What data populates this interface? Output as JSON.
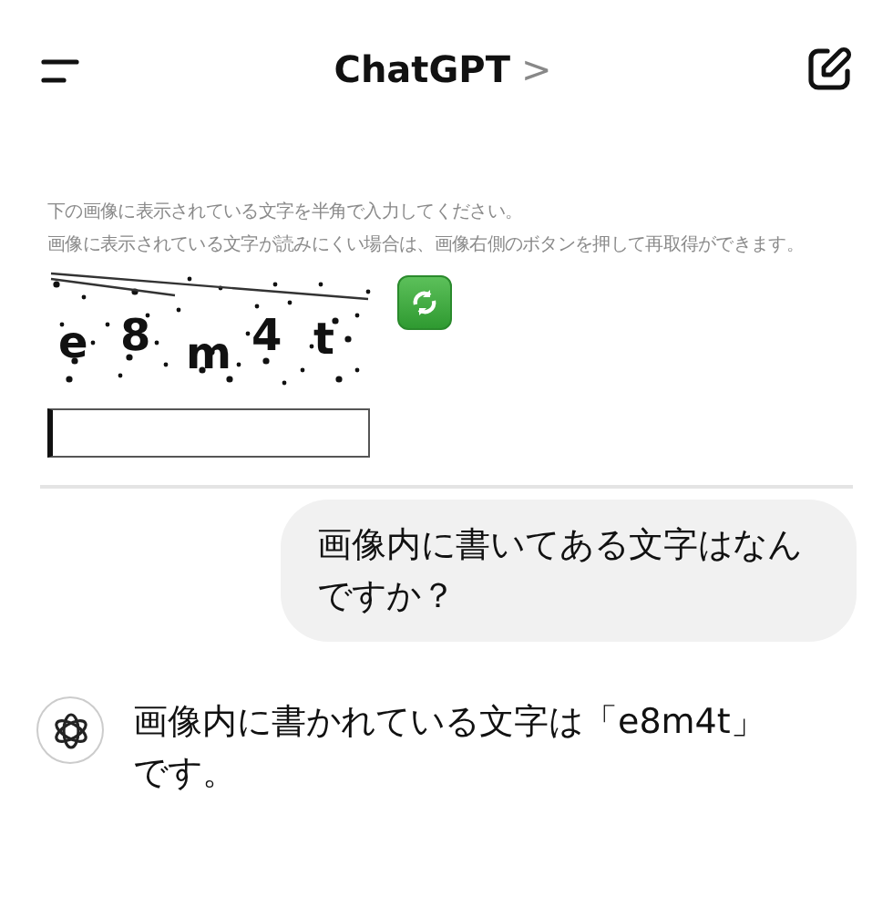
{
  "header": {
    "title": "ChatGPT",
    "chevron": ">"
  },
  "attachment": {
    "instructions": [
      "下の画像に表示されている文字を半角で入力してください。",
      "画像に表示されている文字が読みにくい場合は、画像右側のボタンを押して再取得ができます。"
    ],
    "captcha_chars": [
      "e",
      "8",
      "m",
      "4",
      "t"
    ]
  },
  "messages": [
    {
      "kind": "user",
      "text": "画像内に書いてある文字はなんですか？"
    },
    {
      "kind": "assistant",
      "text": "画像内に書かれている文字は「e8m4t」です。"
    }
  ]
}
